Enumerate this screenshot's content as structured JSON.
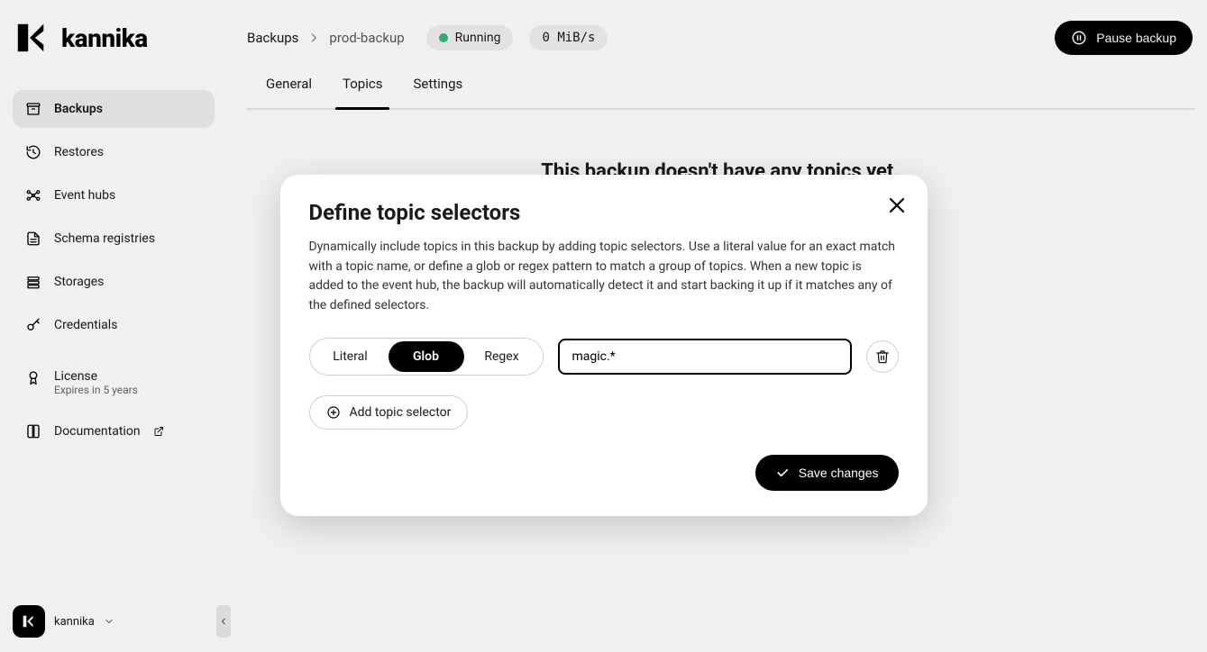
{
  "brand": "kannika",
  "header": {
    "breadcrumb_parent": "Backups",
    "breadcrumb_current": "prod-backup",
    "status_label": "Running",
    "rate_label": "0 MiB/s",
    "pause_label": "Pause backup"
  },
  "sidebar": {
    "items": [
      {
        "label": "Backups"
      },
      {
        "label": "Restores"
      },
      {
        "label": "Event hubs"
      },
      {
        "label": "Schema registries"
      },
      {
        "label": "Storages"
      },
      {
        "label": "Credentials"
      }
    ],
    "license": {
      "label": "License",
      "sub": "Expires in 5 years"
    },
    "documentation_label": "Documentation"
  },
  "main": {
    "tabs": [
      {
        "label": "General"
      },
      {
        "label": "Topics"
      },
      {
        "label": "Settings"
      }
    ],
    "empty_title": "This backup doesn't have any topics yet."
  },
  "modal": {
    "title": "Define topic selectors",
    "description": "Dynamically include topics in this backup by adding topic selectors. Use a literal value for an exact match with a topic name, or define a glob or regex pattern to match a group of topics. When a new topic is added to the event hub, the backup will automatically detect it and start backing it up if it matches any of the defined selectors.",
    "seg": {
      "literal": "Literal",
      "glob": "Glob",
      "regex": "Regex"
    },
    "input_value": "magic.*",
    "add_label": "Add topic selector",
    "save_label": "Save changes"
  },
  "user": {
    "name": "kannika"
  }
}
